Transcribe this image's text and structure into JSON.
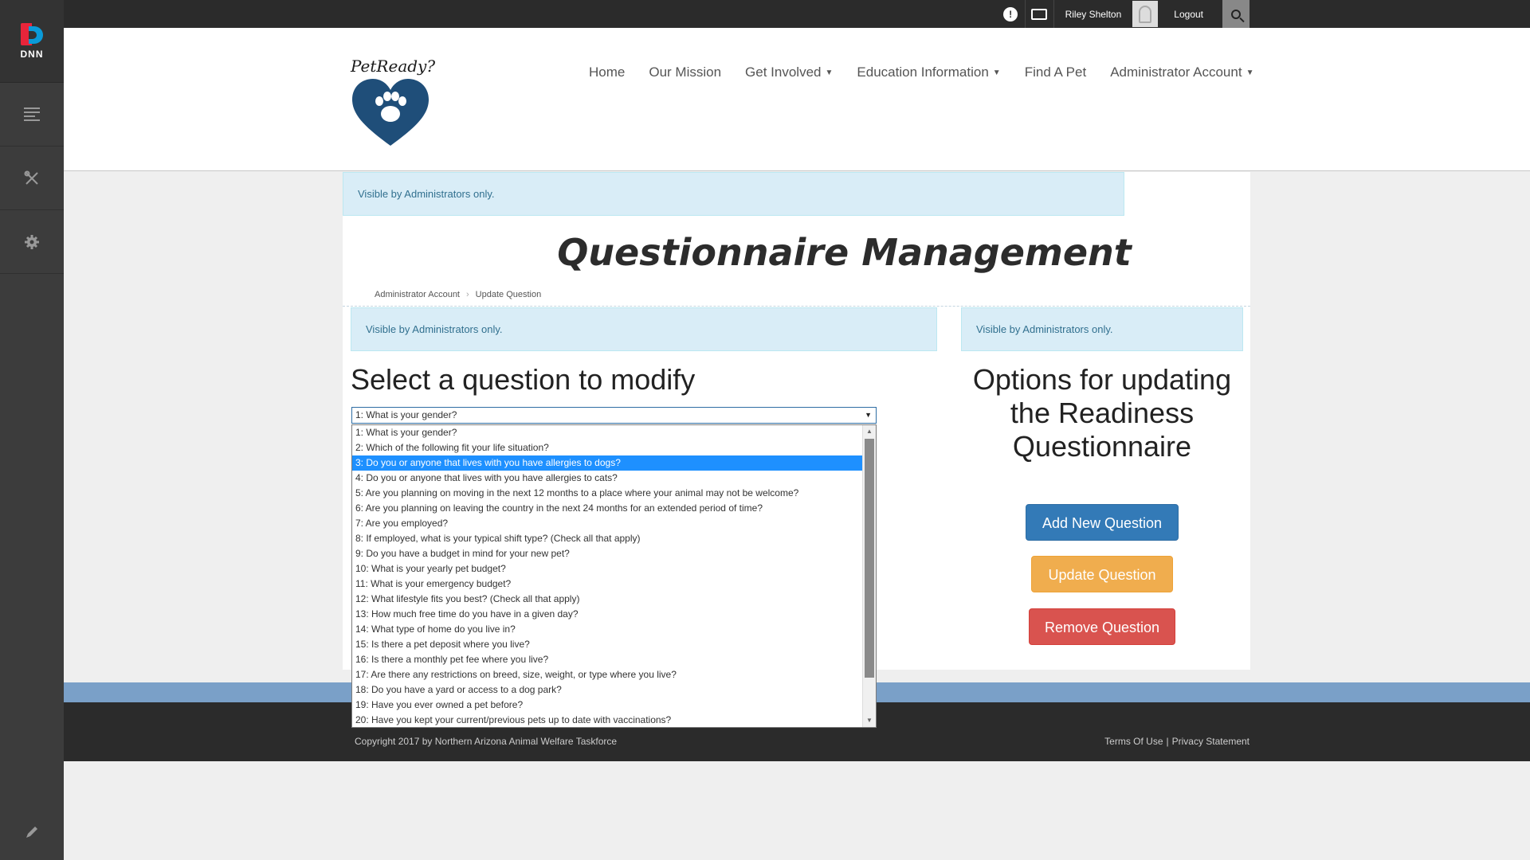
{
  "persona": {
    "logo_text": "DNN",
    "items": [
      "content-icon",
      "tools-icon",
      "settings-icon"
    ],
    "edit_icon": "pencil-icon"
  },
  "topbar": {
    "user_name": "Riley Shelton",
    "logout": "Logout",
    "notification_badge": "!"
  },
  "brand": {
    "name": "PetReady?"
  },
  "nav": [
    {
      "label": "Home",
      "dropdown": false
    },
    {
      "label": "Our Mission",
      "dropdown": false
    },
    {
      "label": "Get Involved",
      "dropdown": true
    },
    {
      "label": "Education Information",
      "dropdown": true
    },
    {
      "label": "Find A Pet",
      "dropdown": false
    },
    {
      "label": "Administrator Account",
      "dropdown": true
    }
  ],
  "alerts": {
    "admin_only": "Visible by Administrators only."
  },
  "page": {
    "title": "Questionnaire Management",
    "breadcrumb": [
      "Administrator Account",
      "Update Question"
    ]
  },
  "left": {
    "heading": "Select a question to modify",
    "selected_value": "1: What is your gender?",
    "options": [
      "1: What is your gender?",
      "2: Which of the following fit your life situation?",
      "3: Do you or anyone that lives with you have allergies to dogs?",
      "4: Do you or anyone that lives with you have allergies to cats?",
      "5: Are you planning on moving in the next 12 months to a place where your animal may not be welcome?",
      "6: Are you planning on leaving the country in the next 24 months for an extended period of time?",
      "7: Are you employed?",
      "8: If employed, what is your typical shift type? (Check all that apply)",
      "9: Do you have a budget in mind for your new pet?",
      "10: What is your yearly pet budget?",
      "11: What is your emergency budget?",
      "12: What lifestyle fits you best? (Check all that apply)",
      "13: How much free time do you have in a given day?",
      "14: What type of home do you live in?",
      "15: Is there a pet deposit where you live?",
      "16: Is there a monthly pet fee where you live?",
      "17: Are there any restrictions on breed, size, weight, or type where you live?",
      "18: Do you have a yard or access to a dog park?",
      "19: Have you ever owned a pet before?",
      "20: Have you kept your current/previous pets up to date with vaccinations?"
    ],
    "highlighted_index": 2
  },
  "right": {
    "heading": "Options for updating the Readiness Questionnaire",
    "buttons": {
      "add": "Add New Question",
      "update": "Update Question",
      "remove": "Remove Question"
    }
  },
  "footer": {
    "copyright": "Copyright 2017 by Northern Arizona Animal Welfare Taskforce",
    "terms": "Terms Of Use",
    "separator": "|",
    "privacy": "Privacy Statement"
  },
  "colors": {
    "primary": "#337ab7",
    "warning": "#f0ad4e",
    "danger": "#d9534f",
    "alert_bg": "#d9edf7",
    "highlight": "#1e90ff",
    "heart": "#1f4e79"
  }
}
